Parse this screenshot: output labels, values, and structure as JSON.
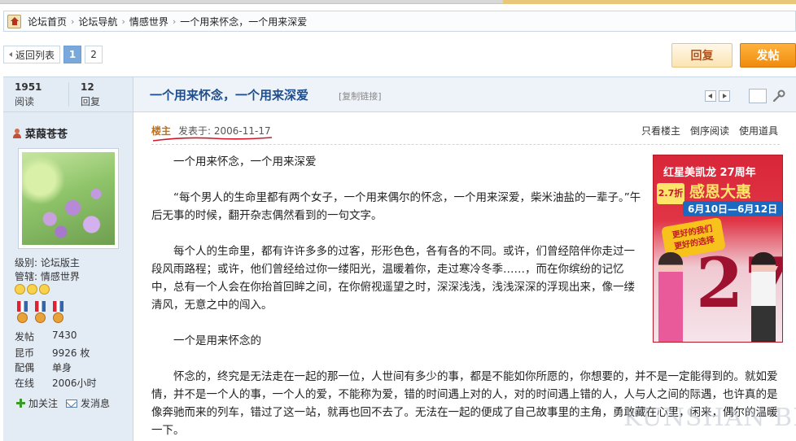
{
  "breadcrumb": [
    "论坛首页",
    "论坛导航",
    "情感世界",
    "一个用来怀念，一个用来深爱"
  ],
  "pager": {
    "back_label": "返回列表",
    "pages": [
      "1",
      "2"
    ],
    "current": "1"
  },
  "buttons": {
    "reply": "回复",
    "post": "发帖"
  },
  "stats": {
    "views_num": "1951",
    "views_label": "阅读",
    "replies_num": "12",
    "replies_label": "回复"
  },
  "thread": {
    "title": "一个用来怀念，一个用来深爱",
    "copy_link": "[复制链接]"
  },
  "user": {
    "name": "菜葭苍苍",
    "level": "级别: 论坛版主",
    "manages": "管辖: 情感世界",
    "stats": [
      {
        "label": "发帖",
        "value": "7430"
      },
      {
        "label": "昆币",
        "value": "9926 枚"
      },
      {
        "label": "配偶",
        "value": "单身"
      },
      {
        "label": "在线",
        "value": "2006小时"
      }
    ],
    "follow": "加关注",
    "message": "发消息"
  },
  "post": {
    "op_label": "楼主",
    "posted": "发表于: 2006-11-17",
    "actions": [
      "只看楼主",
      "倒序阅读",
      "使用道具"
    ],
    "paragraphs": [
      "一个用来怀念，一个用来深爱",
      "“每个男人的生命里都有两个女子，一个用来偶尔的怀念，一个用来深爱，柴米油盐的一辈子。”午后无事的时候，翻开杂志偶然看到的一句文字。",
      "每个人的生命里，都有许许多多的过客，形形色色，各有各的不同。或许，们曾经陪伴你走过一段风雨路程；或许，他们曾经给过你一缕阳光，温暖着你，走过寒冷冬季……，而在你缤纷的记忆中，总有一个人会在你抬首回眸之间，在你俯视遥望之时，深深浅浅，浅浅深深的浮现出来，像一缕清风，无意之中的闯入。",
      "一个是用来怀念的"
    ],
    "paragraph_wide": "怀念的，终究是无法走在一起的那一位，人世间有多少的事，都是不能如你所愿的，你想要的，并不是一定能得到的。就如爱情，并不是一个人的事，一个人的爱，不能称为爱，错的时间遇上对的人，对的时间遇上错的人，人与人之间的际遇，也许真的是像奔驰而来的列车，错过了这一站，就再也回不去了。无法在一起的便成了自己故事里的主角，勇敢藏在心里，闲来，偶尔的温暖一下。"
  },
  "ad": {
    "line1": "红星美凯龙 27周年",
    "line2": "感恩大惠",
    "line3": "6月10日—6月12日",
    "badge": "2.7折",
    "bubble_line1": "更好的我们",
    "bubble_line2": "更好的选择",
    "number": "27"
  },
  "watermark": "KUNSHAN BBS",
  "colors": {
    "title_blue": "#1f4e8c",
    "post_orange": "#f08b0e",
    "op_orange": "#c0701a",
    "sidebar_bg": "#e3ebf5"
  }
}
